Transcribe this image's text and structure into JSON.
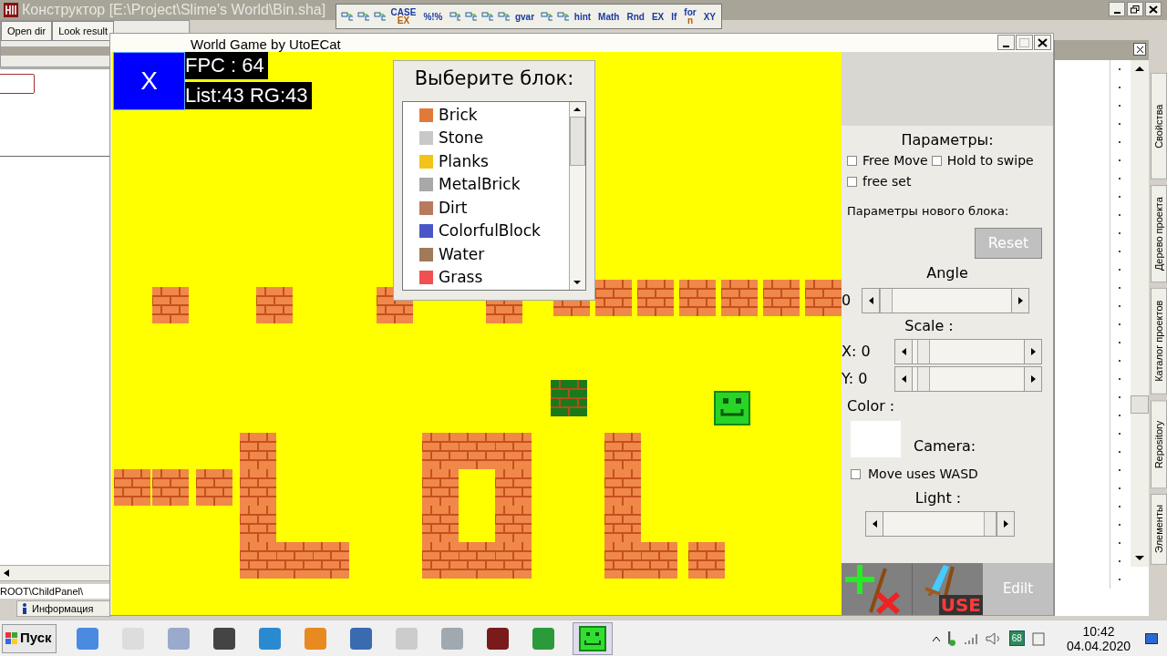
{
  "ide": {
    "title": "Конструктор [E:\\Project\\Slime's World\\Bin.sha]",
    "toolbar": [
      {
        "kind": "icon"
      },
      {
        "kind": "icon"
      },
      {
        "kind": "icon"
      },
      {
        "kind": "text",
        "label": "CASE",
        "sub": "EX"
      },
      {
        "kind": "text",
        "label": "%!%"
      },
      {
        "kind": "icon"
      },
      {
        "kind": "icon"
      },
      {
        "kind": "icon"
      },
      {
        "kind": "icon"
      },
      {
        "kind": "text",
        "label": "gvar"
      },
      {
        "kind": "icon"
      },
      {
        "kind": "icon"
      },
      {
        "kind": "text",
        "label": "hint"
      },
      {
        "kind": "text",
        "label": "Math"
      },
      {
        "kind": "text",
        "label": "Rnd"
      },
      {
        "kind": "text",
        "label": "EX"
      },
      {
        "kind": "text",
        "label": "If"
      },
      {
        "kind": "text",
        "label": "for",
        "sub": "n"
      },
      {
        "kind": "text",
        "label": "XY"
      }
    ],
    "path": "ROOT\\ChildPanel\\",
    "info_tab": "Информация",
    "side_tabs": [
      "Свойства",
      "Дерево проекта",
      "Каталог проектов",
      "Repository",
      "Элементы"
    ]
  },
  "popup": {
    "buttons": [
      "Open dir",
      "Look result"
    ]
  },
  "game": {
    "title": "World Game by UtoECat",
    "close_label": "X",
    "fpc": "FPC : 64",
    "list": "List:43 RG:43",
    "chooser": {
      "title": "Выберите блок:",
      "items": [
        {
          "label": "Brick",
          "color": "#e07a3a"
        },
        {
          "label": "Stone",
          "color": "#c8c8c8"
        },
        {
          "label": "Planks",
          "color": "#f2c419"
        },
        {
          "label": "MetalBrick",
          "color": "#a8a8a8"
        },
        {
          "label": "Dirt",
          "color": "#b87a5c"
        },
        {
          "label": "ColorfulBlock",
          "color": "#4a56c8"
        },
        {
          "label": "Water",
          "color": "#a07a5a"
        },
        {
          "label": "Grass",
          "color": "#f05050"
        }
      ]
    }
  },
  "panel": {
    "params_title": "Параметры:",
    "checks": [
      {
        "label": "Free Move",
        "checked": false
      },
      {
        "label": "Hold to swipe",
        "checked": false
      },
      {
        "label": "free set",
        "checked": false
      }
    ],
    "new_block": "Параметры нового блока:",
    "reset": {
      "label": "Reset",
      "disabled": true
    },
    "angle_label": "Angle",
    "angle_value": "0",
    "angle": {
      "level": 0
    },
    "scale_label": "Scale :",
    "x_label": "X: 0",
    "x": {
      "level": 0.05
    },
    "y_label": "Y: 0",
    "y": {
      "level": 0.05
    },
    "color_label": "Color :",
    "color": "#ffffff",
    "camera_label": "Camera:",
    "wasd": {
      "label": "Move uses WASD",
      "checked": false
    },
    "light_label": "Light :",
    "light": {
      "level": 1
    },
    "use_label": "USE",
    "edit_label": "Edilt"
  },
  "taskbar": {
    "start": "Пуск",
    "tray_badge": "68",
    "time": "10:42",
    "date": "04.04.2020"
  }
}
